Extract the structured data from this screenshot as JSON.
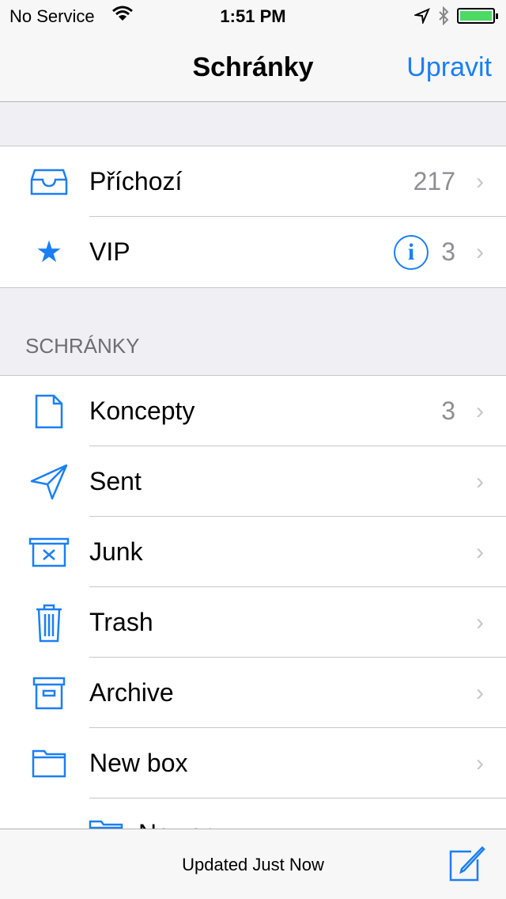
{
  "status_bar": {
    "carrier": "No Service",
    "time": "1:51 PM",
    "battery_level": 1.0,
    "battery_color": "#4cd964"
  },
  "nav": {
    "title": "Schránky",
    "edit_label": "Upravit"
  },
  "accent": "#1a7ff5",
  "top_group": [
    {
      "label": "Příchozí",
      "count": "217",
      "icon": "inbox-icon"
    },
    {
      "label": "VIP",
      "count": "3",
      "icon": "star-icon",
      "info": "i"
    }
  ],
  "section_header": "SCHRÁNKY",
  "mailboxes": [
    {
      "label": "Koncepty",
      "count": "3",
      "icon": "draft-icon"
    },
    {
      "label": "Sent",
      "count": "",
      "icon": "paper-plane-icon"
    },
    {
      "label": "Junk",
      "count": "",
      "icon": "junk-icon"
    },
    {
      "label": "Trash",
      "count": "",
      "icon": "trash-icon"
    },
    {
      "label": "Archive",
      "count": "",
      "icon": "archive-icon"
    },
    {
      "label": "New box",
      "count": "",
      "icon": "folder-icon"
    },
    {
      "label": "Newer",
      "count": "",
      "icon": "folder-icon"
    }
  ],
  "toolbar": {
    "status": "Updated Just Now"
  }
}
